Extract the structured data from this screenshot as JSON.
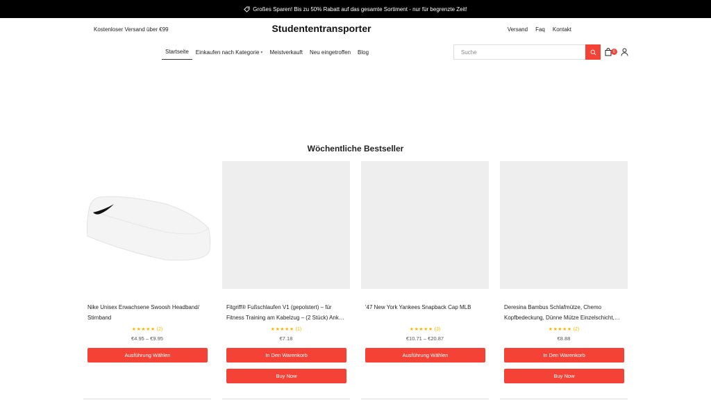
{
  "announcement": {
    "icon": "tag-icon",
    "text": "Großes Sparen! Bis zu 50% Rabatt auf das gesamte Sortiment - nur für begrenzte Zeit!"
  },
  "header": {
    "shipping_note": "Kostenloser Versand über €99",
    "logo": "Studententransporter",
    "top_links": [
      "Versand",
      "Faq",
      "Kontakt"
    ]
  },
  "nav": {
    "items": [
      "Startseite",
      "Einkaufen nach Kategorie",
      "Meistverkauft",
      "Neu eingetroffen",
      "Blog"
    ],
    "active": "Startseite"
  },
  "search": {
    "placeholder": "Suche",
    "value": ""
  },
  "cart": {
    "count": "0"
  },
  "colors": {
    "accent": "#f44336",
    "star": "#f5b800",
    "topbar": "#000000"
  },
  "section": {
    "title": "Wöchentliche Bestseller"
  },
  "products": [
    {
      "title": "Nike Unisex Erwachsene Swoosh Headband/ Stirnband",
      "stars": "★★★★★",
      "reviews": "(2)",
      "price": "€4.95 – €9.95",
      "button1": "Ausführung Wählen",
      "button2": ""
    },
    {
      "title": "Fitgriff® Fußschlaufen V1 (gepolstert) – für Fitness Training am Kabelzug – (2 Stück) Ank…",
      "stars": "★★★★★",
      "reviews": "(1)",
      "price": "€7.18",
      "button1": "In Den Warenkorb",
      "button2": "Buy Now"
    },
    {
      "title": "'47 New York Yankees Snapback Cap MLB",
      "stars": "★★★★★",
      "reviews": "(3)",
      "price": "€10.71 – €20.87",
      "button1": "Ausführung Wählen",
      "button2": ""
    },
    {
      "title": "Deresina Bambus Schlafmütze, Chemo Kopfbedeckung, Dünne Mütze Einzelschicht, At…",
      "stars": "★★★★★",
      "reviews": "(2)",
      "price": "€8.88",
      "button1": "In Den Warenkorb",
      "button2": "Buy Now"
    }
  ]
}
